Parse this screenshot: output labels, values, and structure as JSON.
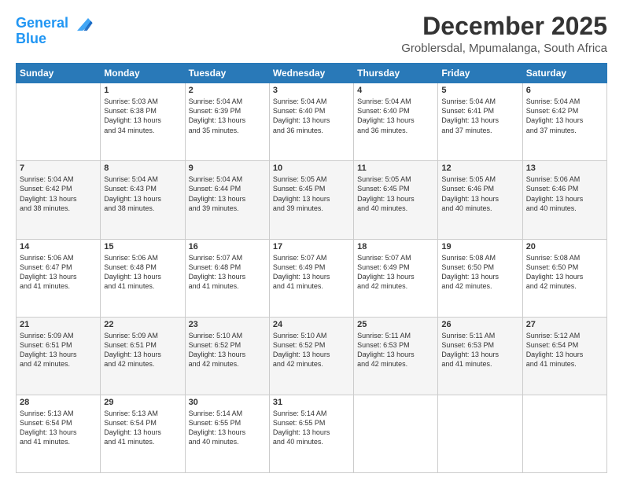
{
  "header": {
    "logo_line1": "General",
    "logo_line2": "Blue",
    "title": "December 2025",
    "subtitle": "Groblersdal, Mpumalanga, South Africa"
  },
  "days_of_week": [
    "Sunday",
    "Monday",
    "Tuesday",
    "Wednesday",
    "Thursday",
    "Friday",
    "Saturday"
  ],
  "weeks": [
    [
      {
        "day": "",
        "info": ""
      },
      {
        "day": "1",
        "info": "Sunrise: 5:03 AM\nSunset: 6:38 PM\nDaylight: 13 hours\nand 34 minutes."
      },
      {
        "day": "2",
        "info": "Sunrise: 5:04 AM\nSunset: 6:39 PM\nDaylight: 13 hours\nand 35 minutes."
      },
      {
        "day": "3",
        "info": "Sunrise: 5:04 AM\nSunset: 6:40 PM\nDaylight: 13 hours\nand 36 minutes."
      },
      {
        "day": "4",
        "info": "Sunrise: 5:04 AM\nSunset: 6:40 PM\nDaylight: 13 hours\nand 36 minutes."
      },
      {
        "day": "5",
        "info": "Sunrise: 5:04 AM\nSunset: 6:41 PM\nDaylight: 13 hours\nand 37 minutes."
      },
      {
        "day": "6",
        "info": "Sunrise: 5:04 AM\nSunset: 6:42 PM\nDaylight: 13 hours\nand 37 minutes."
      }
    ],
    [
      {
        "day": "7",
        "info": "Sunrise: 5:04 AM\nSunset: 6:42 PM\nDaylight: 13 hours\nand 38 minutes."
      },
      {
        "day": "8",
        "info": "Sunrise: 5:04 AM\nSunset: 6:43 PM\nDaylight: 13 hours\nand 38 minutes."
      },
      {
        "day": "9",
        "info": "Sunrise: 5:04 AM\nSunset: 6:44 PM\nDaylight: 13 hours\nand 39 minutes."
      },
      {
        "day": "10",
        "info": "Sunrise: 5:05 AM\nSunset: 6:45 PM\nDaylight: 13 hours\nand 39 minutes."
      },
      {
        "day": "11",
        "info": "Sunrise: 5:05 AM\nSunset: 6:45 PM\nDaylight: 13 hours\nand 40 minutes."
      },
      {
        "day": "12",
        "info": "Sunrise: 5:05 AM\nSunset: 6:46 PM\nDaylight: 13 hours\nand 40 minutes."
      },
      {
        "day": "13",
        "info": "Sunrise: 5:06 AM\nSunset: 6:46 PM\nDaylight: 13 hours\nand 40 minutes."
      }
    ],
    [
      {
        "day": "14",
        "info": "Sunrise: 5:06 AM\nSunset: 6:47 PM\nDaylight: 13 hours\nand 41 minutes."
      },
      {
        "day": "15",
        "info": "Sunrise: 5:06 AM\nSunset: 6:48 PM\nDaylight: 13 hours\nand 41 minutes."
      },
      {
        "day": "16",
        "info": "Sunrise: 5:07 AM\nSunset: 6:48 PM\nDaylight: 13 hours\nand 41 minutes."
      },
      {
        "day": "17",
        "info": "Sunrise: 5:07 AM\nSunset: 6:49 PM\nDaylight: 13 hours\nand 41 minutes."
      },
      {
        "day": "18",
        "info": "Sunrise: 5:07 AM\nSunset: 6:49 PM\nDaylight: 13 hours\nand 42 minutes."
      },
      {
        "day": "19",
        "info": "Sunrise: 5:08 AM\nSunset: 6:50 PM\nDaylight: 13 hours\nand 42 minutes."
      },
      {
        "day": "20",
        "info": "Sunrise: 5:08 AM\nSunset: 6:50 PM\nDaylight: 13 hours\nand 42 minutes."
      }
    ],
    [
      {
        "day": "21",
        "info": "Sunrise: 5:09 AM\nSunset: 6:51 PM\nDaylight: 13 hours\nand 42 minutes."
      },
      {
        "day": "22",
        "info": "Sunrise: 5:09 AM\nSunset: 6:51 PM\nDaylight: 13 hours\nand 42 minutes."
      },
      {
        "day": "23",
        "info": "Sunrise: 5:10 AM\nSunset: 6:52 PM\nDaylight: 13 hours\nand 42 minutes."
      },
      {
        "day": "24",
        "info": "Sunrise: 5:10 AM\nSunset: 6:52 PM\nDaylight: 13 hours\nand 42 minutes."
      },
      {
        "day": "25",
        "info": "Sunrise: 5:11 AM\nSunset: 6:53 PM\nDaylight: 13 hours\nand 42 minutes."
      },
      {
        "day": "26",
        "info": "Sunrise: 5:11 AM\nSunset: 6:53 PM\nDaylight: 13 hours\nand 41 minutes."
      },
      {
        "day": "27",
        "info": "Sunrise: 5:12 AM\nSunset: 6:54 PM\nDaylight: 13 hours\nand 41 minutes."
      }
    ],
    [
      {
        "day": "28",
        "info": "Sunrise: 5:13 AM\nSunset: 6:54 PM\nDaylight: 13 hours\nand 41 minutes."
      },
      {
        "day": "29",
        "info": "Sunrise: 5:13 AM\nSunset: 6:54 PM\nDaylight: 13 hours\nand 41 minutes."
      },
      {
        "day": "30",
        "info": "Sunrise: 5:14 AM\nSunset: 6:55 PM\nDaylight: 13 hours\nand 40 minutes."
      },
      {
        "day": "31",
        "info": "Sunrise: 5:14 AM\nSunset: 6:55 PM\nDaylight: 13 hours\nand 40 minutes."
      },
      {
        "day": "",
        "info": ""
      },
      {
        "day": "",
        "info": ""
      },
      {
        "day": "",
        "info": ""
      }
    ]
  ]
}
